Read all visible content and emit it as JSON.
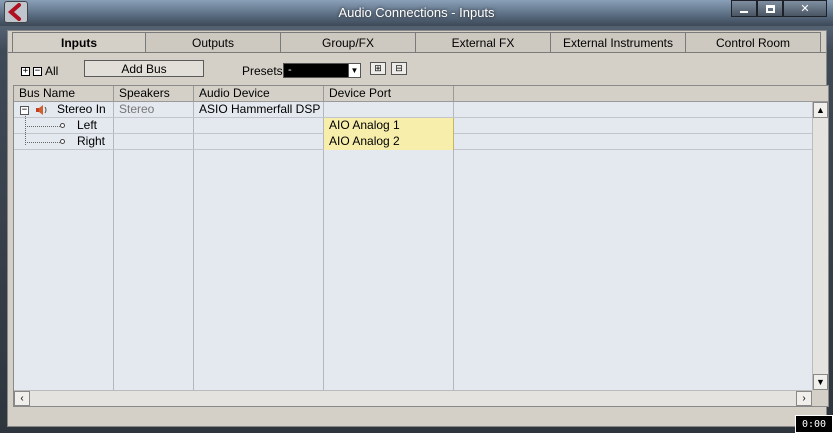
{
  "window": {
    "title": "Audio Connections - Inputs",
    "buttons": {
      "minimize": "minimize",
      "maximize": "maximize",
      "close": "✕"
    }
  },
  "tabs": [
    {
      "label": "Inputs",
      "active": true
    },
    {
      "label": "Outputs",
      "active": false
    },
    {
      "label": "Group/FX",
      "active": false
    },
    {
      "label": "External FX",
      "active": false
    },
    {
      "label": "External Instruments",
      "active": false
    },
    {
      "label": "Control Room",
      "active": false
    }
  ],
  "toolbar": {
    "expand_all": "+",
    "collapse_all": "−",
    "all_label": "All",
    "add_bus_label": "Add Bus",
    "presets_label": "Presets",
    "presets_value": "-"
  },
  "grid": {
    "columns": [
      "Bus Name",
      "Speakers",
      "Audio Device",
      "Device Port"
    ],
    "rows": [
      {
        "bus_name": "Stereo In",
        "speakers": "Stereo",
        "audio_device": "ASIO Hammerfall DSP",
        "device_port": ""
      },
      {
        "bus_name": "Left",
        "speakers": "",
        "audio_device": "",
        "device_port": "AIO Analog 1"
      },
      {
        "bus_name": "Right",
        "speakers": "",
        "audio_device": "",
        "device_port": "AIO Analog 2"
      }
    ]
  },
  "overlay": {
    "timer": "0:00"
  }
}
